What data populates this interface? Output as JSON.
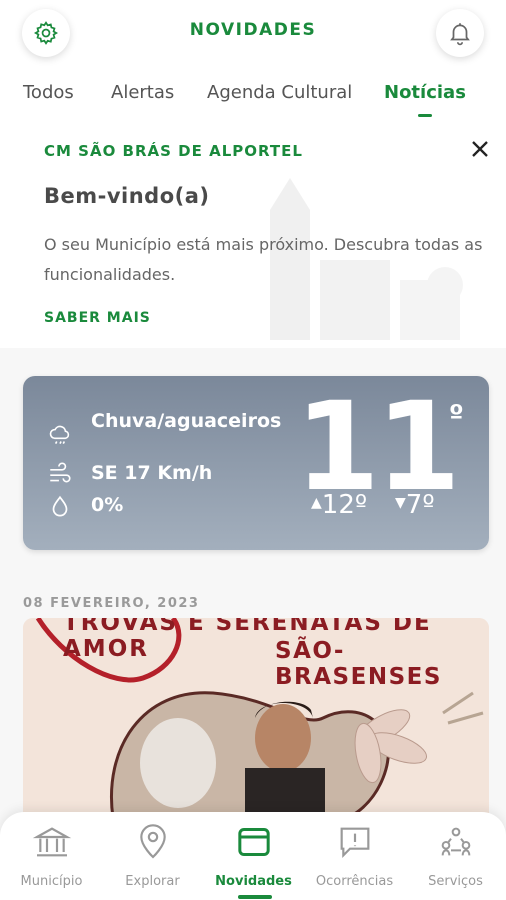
{
  "header": {
    "title": "NOVIDADES",
    "settings_icon": "gear-icon",
    "notifications_icon": "bell-icon"
  },
  "tabs": [
    {
      "label": "Todos",
      "active": false
    },
    {
      "label": "Alertas",
      "active": false
    },
    {
      "label": "Agenda Cultural",
      "active": false
    },
    {
      "label": "Notícias",
      "active": true
    }
  ],
  "welcome_card": {
    "label": "CM SÃO BRÁS DE ALPORTEL",
    "title": "Bem-vindo(a)",
    "text": "O seu Município está mais próximo. Descubra todas as funcionalidades.",
    "link": "SABER MAIS",
    "close_icon": "close-icon"
  },
  "weather": {
    "condition": "Chuva/aguaceiros",
    "wind": "SE 17 Km/h",
    "precipitation": "0%",
    "temperature": "11",
    "degree_symbol": "º",
    "max": "12º",
    "min": "7º"
  },
  "news": {
    "date": "08 FEVEREIRO, 2023",
    "image_title_line1": "TROVAS E SERENATAS DE AMOR",
    "image_title_line2": "SÃO-BRASENSES"
  },
  "bottom_nav": [
    {
      "label": "Município",
      "icon": "building-icon",
      "active": false
    },
    {
      "label": "Explorar",
      "icon": "map-pin-icon",
      "active": false
    },
    {
      "label": "Novidades",
      "icon": "news-icon",
      "active": true
    },
    {
      "label": "Ocorrências",
      "icon": "report-icon",
      "active": false
    },
    {
      "label": "Serviços",
      "icon": "services-icon",
      "active": false
    }
  ],
  "colors": {
    "accent": "#1a8a3c",
    "weather_top": "#7b889a",
    "weather_bottom": "#a3afbd"
  }
}
